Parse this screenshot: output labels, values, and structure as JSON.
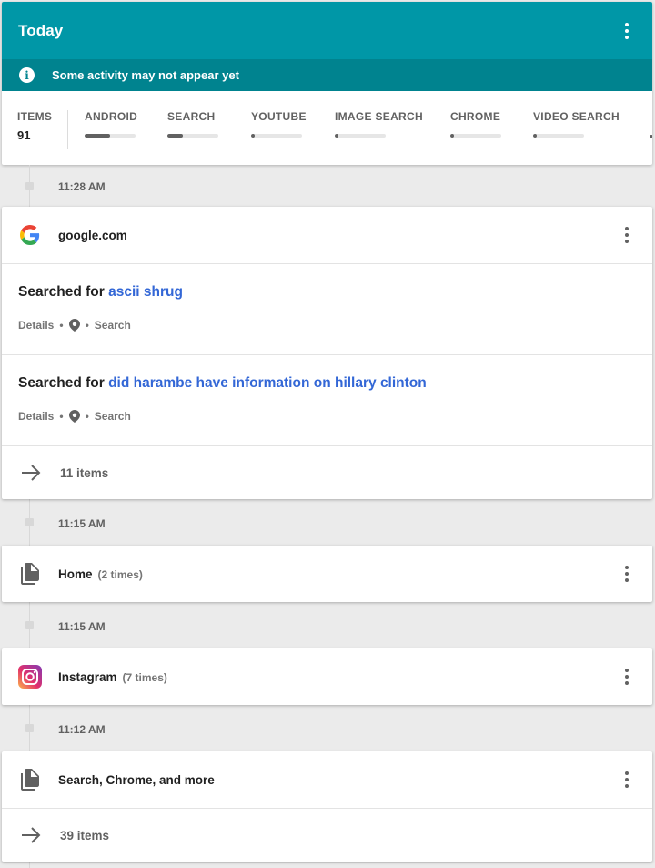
{
  "header": {
    "title": "Today",
    "notice": "Some activity may not appear yet"
  },
  "filters": {
    "items_label": "ITEMS",
    "items_count": "91",
    "chips": [
      {
        "label": "ANDROID",
        "fraction": 0.5
      },
      {
        "label": "SEARCH",
        "fraction": 0.3
      },
      {
        "label": "YOUTUBE",
        "fraction": 0.08
      },
      {
        "label": "IMAGE SEARCH",
        "fraction": 0.08
      },
      {
        "label": "CHROME",
        "fraction": 0.08
      },
      {
        "label": "VIDEO SEARCH",
        "fraction": 0.08
      }
    ]
  },
  "groups": [
    {
      "time": "11:28 AM",
      "icon": "google-icon",
      "title": "google.com",
      "count_text": "",
      "entries": [
        {
          "prefix": "Searched for",
          "query": "ascii shrug",
          "details": "Details",
          "product": "Search"
        },
        {
          "prefix": "Searched for",
          "query": "did harambe have information on hillary clinton",
          "details": "Details",
          "product": "Search"
        }
      ],
      "more": "11 items"
    },
    {
      "time": "11:15 AM",
      "icon": "file-copy-icon",
      "title": "Home",
      "count_text": "(2 times)"
    },
    {
      "time": "11:15 AM",
      "icon": "instagram-icon",
      "title": "Instagram",
      "count_text": "(7 times)"
    },
    {
      "time": "11:12 AM",
      "icon": "file-copy-icon",
      "title": "Search, Chrome, and more",
      "count_text": "",
      "more": "39 items"
    }
  ],
  "colors": {
    "header": "#0097a7",
    "notice": "#00838f",
    "link": "#3367d6"
  }
}
